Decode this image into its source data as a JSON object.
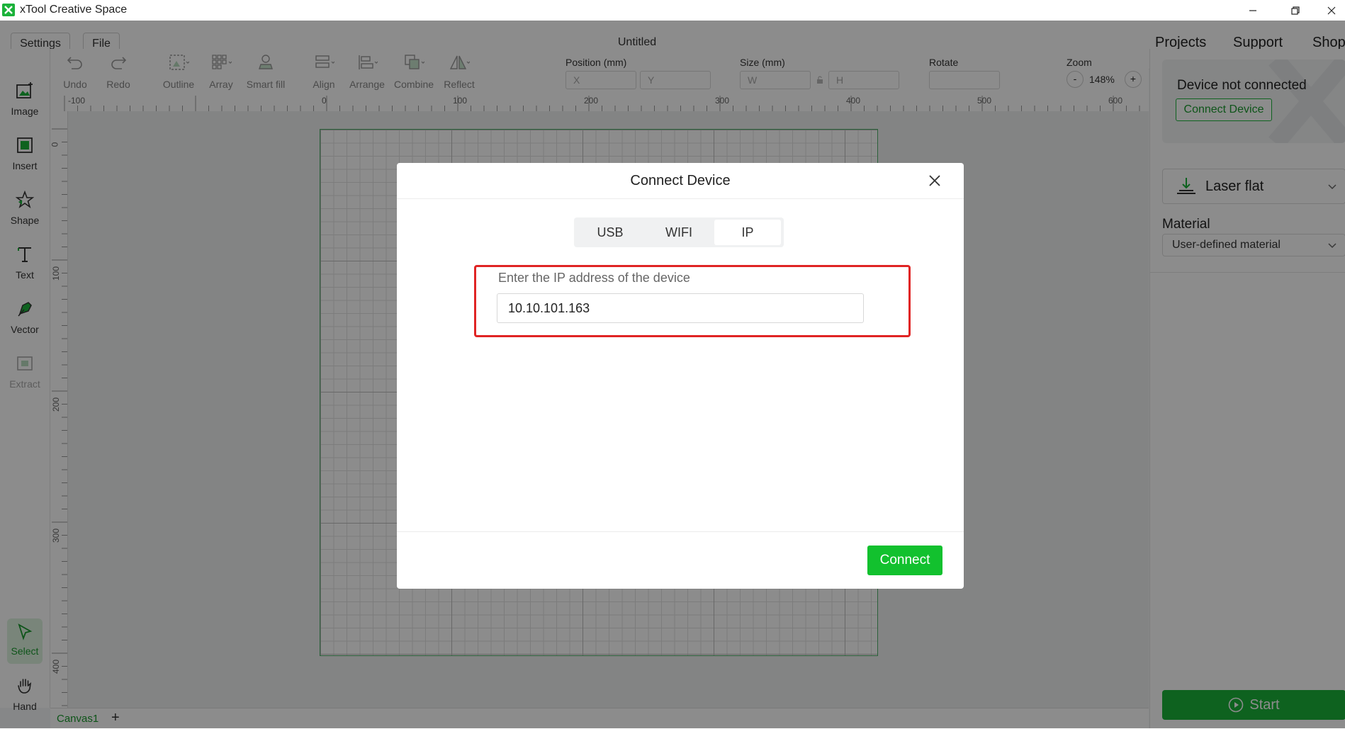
{
  "window": {
    "title": "xTool Creative Space"
  },
  "header": {
    "settings_label": "Settings",
    "file_label": "File",
    "doc_title": "Untitled",
    "nav": [
      "Projects",
      "Support",
      "Shop"
    ]
  },
  "sidebar": {
    "items": [
      {
        "label": "Image",
        "icon": "image-plus-icon"
      },
      {
        "label": "Insert",
        "icon": "insert-frame-icon"
      },
      {
        "label": "Shape",
        "icon": "star-shape-icon"
      },
      {
        "label": "Text",
        "icon": "text-t-icon"
      },
      {
        "label": "Vector",
        "icon": "pen-vector-icon"
      },
      {
        "label": "Extract",
        "icon": "extract-icon"
      },
      {
        "label": "Select",
        "icon": "cursor-icon"
      },
      {
        "label": "Hand",
        "icon": "hand-icon"
      }
    ]
  },
  "toolbar": {
    "items": [
      "Undo",
      "Redo",
      "Outline",
      "Array",
      "Smart fill",
      "Align",
      "Arrange",
      "Combine",
      "Reflect"
    ],
    "position_label": "Position (mm)",
    "x_placeholder": "X",
    "y_placeholder": "Y",
    "size_label": "Size (mm)",
    "w_placeholder": "W",
    "h_placeholder": "H",
    "rotate_label": "Rotate",
    "zoom_label": "Zoom",
    "zoom_value": "148%",
    "zoom_minus": "-",
    "zoom_plus": "+"
  },
  "rulers": {
    "top": [
      "-100",
      "0",
      "100",
      "200",
      "300",
      "400",
      "500",
      "600"
    ],
    "left": [
      "0",
      "100",
      "200",
      "300",
      "400"
    ]
  },
  "canvas_tabs": {
    "active": "Canvas1",
    "add": "+"
  },
  "right_panel": {
    "device_status": "Device not connected",
    "connect_device_label": "Connect Device",
    "mode_label": "Laser flat",
    "material_heading": "Material",
    "material_value": "User-defined material",
    "start_label": "Start"
  },
  "dialog": {
    "title": "Connect Device",
    "tabs": [
      "USB",
      "WIFI",
      "IP"
    ],
    "active_tab": "IP",
    "ip_label": "Enter the IP address of the device",
    "ip_value": "10.10.101.163",
    "connect_label": "Connect"
  },
  "colors": {
    "accent": "#1bb23a",
    "connect_button": "#12c12e",
    "highlight": "#e02424"
  }
}
